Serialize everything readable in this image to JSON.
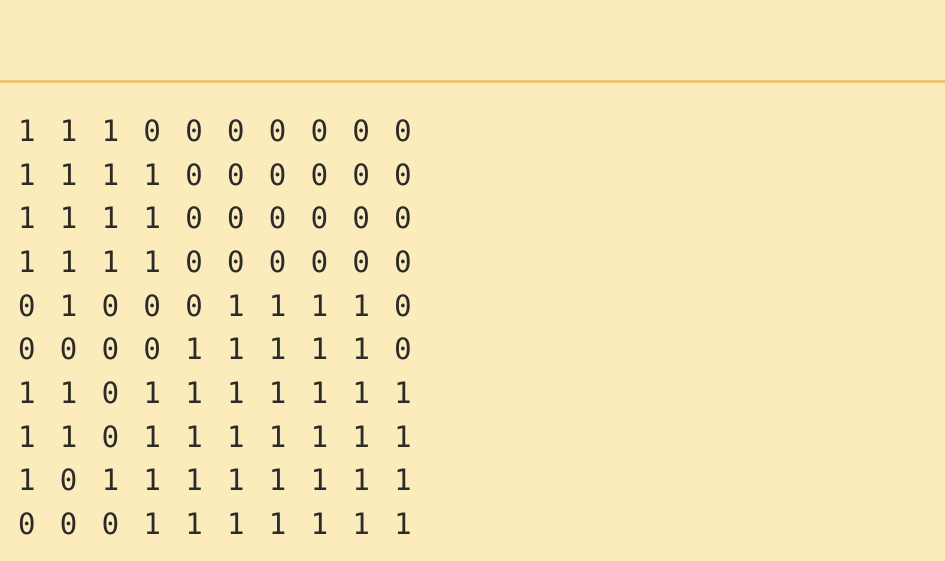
{
  "output": {
    "rows": [
      [
        "1",
        "1",
        "1",
        "0",
        "0",
        "0",
        "0",
        "0",
        "0",
        "0"
      ],
      [
        "1",
        "1",
        "1",
        "1",
        "0",
        "0",
        "0",
        "0",
        "0",
        "0"
      ],
      [
        "1",
        "1",
        "1",
        "1",
        "0",
        "0",
        "0",
        "0",
        "0",
        "0"
      ],
      [
        "1",
        "1",
        "1",
        "1",
        "0",
        "0",
        "0",
        "0",
        "0",
        "0"
      ],
      [
        "0",
        "1",
        "0",
        "0",
        "0",
        "1",
        "1",
        "1",
        "1",
        "0"
      ],
      [
        "0",
        "0",
        "0",
        "0",
        "1",
        "1",
        "1",
        "1",
        "1",
        "0"
      ],
      [
        "1",
        "1",
        "0",
        "1",
        "1",
        "1",
        "1",
        "1",
        "1",
        "1"
      ],
      [
        "1",
        "1",
        "0",
        "1",
        "1",
        "1",
        "1",
        "1",
        "1",
        "1"
      ],
      [
        "1",
        "0",
        "1",
        "1",
        "1",
        "1",
        "1",
        "1",
        "1",
        "1"
      ],
      [
        "0",
        "0",
        "0",
        "1",
        "1",
        "1",
        "1",
        "1",
        "1",
        "1"
      ]
    ]
  },
  "colors": {
    "background": "#fcecbb",
    "divider": "#eac876",
    "text": "#2b2b2b"
  }
}
